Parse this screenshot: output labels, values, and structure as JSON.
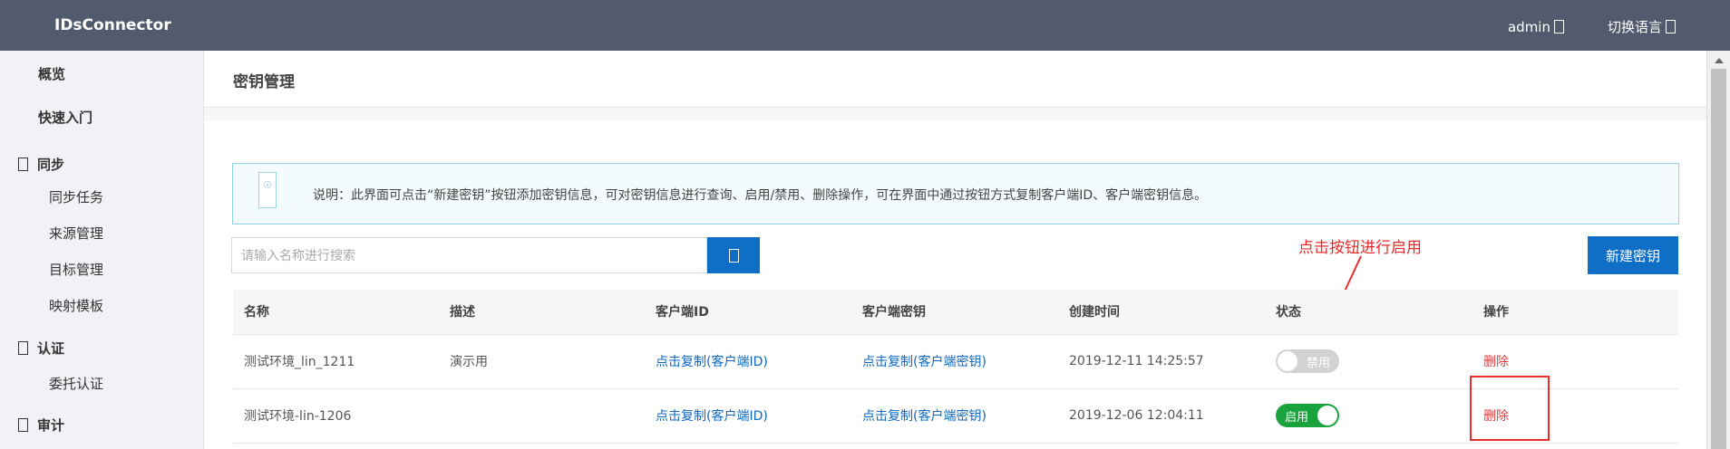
{
  "topbar": {
    "brand": "IDsConnector",
    "user": "admin",
    "language": "切换语言"
  },
  "sidebar": {
    "overview": "概览",
    "quickstart": "快速入门",
    "groups": [
      {
        "label": "同步",
        "items": [
          "同步任务",
          "来源管理",
          "目标管理",
          "映射模板"
        ]
      },
      {
        "label": "认证",
        "items": [
          "委托认证"
        ]
      },
      {
        "label": "审计",
        "items": []
      }
    ]
  },
  "main": {
    "title": "密钥管理",
    "notice": "说明：此界面可点击“新建密钥”按钮添加密钥信息，可对密钥信息进行查询、启用/禁用、删除操作，可在界面中通过按钮方式复制客户端ID、客户端密钥信息。",
    "search_placeholder": "请输入名称进行搜索",
    "new_button": "新建密钥",
    "annotation": "点击按钮进行启用",
    "columns": [
      "名称",
      "描述",
      "客户端ID",
      "客户端密钥",
      "创建时间",
      "状态",
      "操作"
    ],
    "rows": [
      {
        "name": "测试环境_lin_1211",
        "desc": "演示用",
        "client_id": "点击复制(客户端ID)",
        "client_secret": "点击复制(客户端密钥)",
        "created": "2019-12-11 14:25:57",
        "status": "禁用",
        "action": "删除"
      },
      {
        "name": "测试环境-lin-1206",
        "desc": "",
        "client_id": "点击复制(客户端ID)",
        "client_secret": "点击复制(客户端密钥)",
        "created": "2019-12-06 12:04:11",
        "status": "启用",
        "action": "删除"
      }
    ]
  },
  "colors": {
    "topbar": "#525b6e",
    "primary": "#0f6fc6",
    "danger": "#e23b3b",
    "enabled": "#1aa33d",
    "disabled": "#d2d2d2",
    "annotation": "#e62c2c"
  }
}
